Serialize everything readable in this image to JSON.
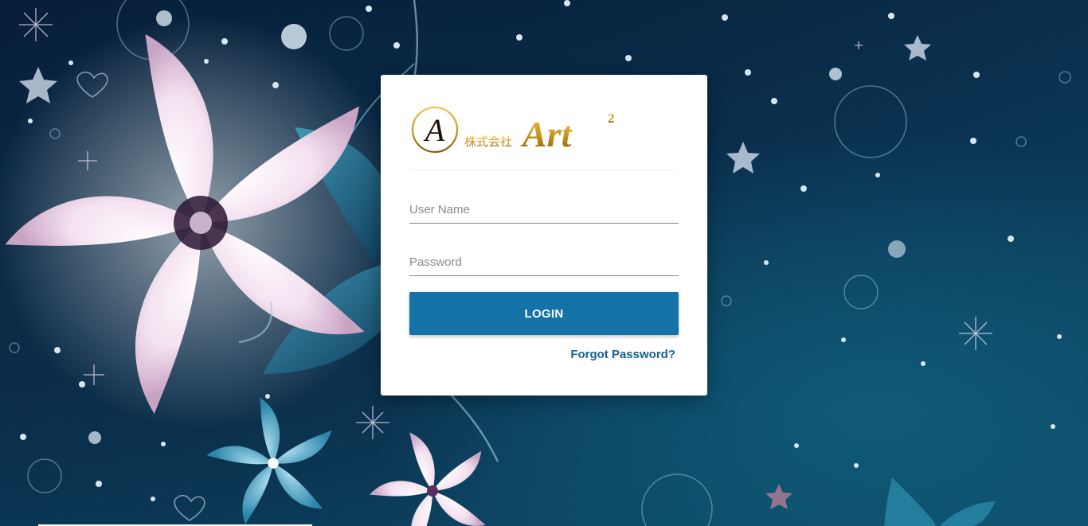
{
  "brand": {
    "japanese": "株式会社",
    "name": "Art",
    "superscript": "2",
    "emblem_letter": "A",
    "gold": "#c8921a"
  },
  "form": {
    "username_placeholder": "User Name",
    "password_placeholder": "Password",
    "login_label": "LOGIN",
    "forgot_label": "Forgot Password?"
  },
  "colors": {
    "primary": "#1472a8",
    "link": "#17608f",
    "background_dark": "#061a33",
    "background_teal": "#0d4f6b"
  }
}
